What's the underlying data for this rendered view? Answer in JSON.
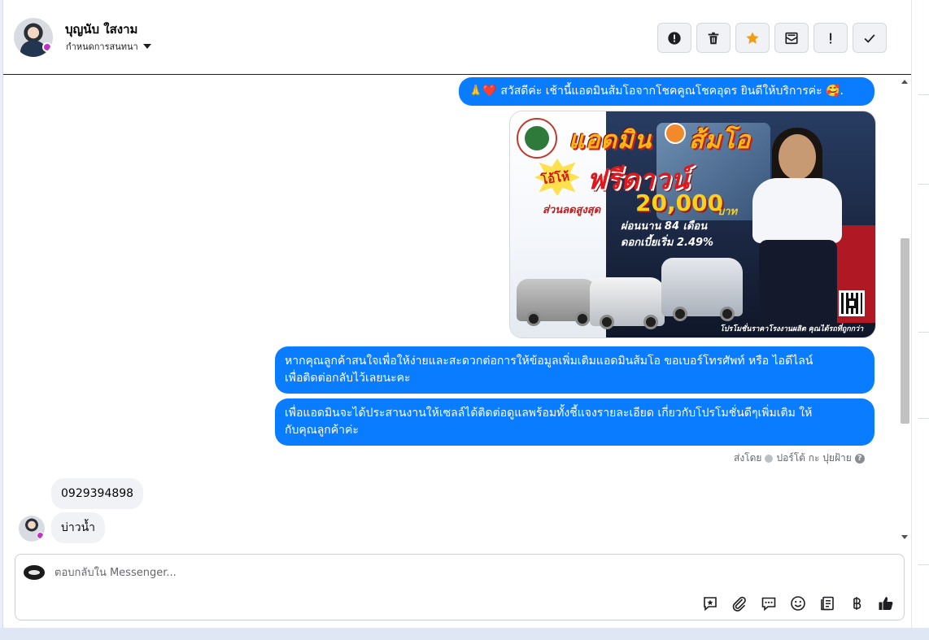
{
  "header": {
    "contact_name": "บุญนับ ใสงาม",
    "assign_label": "กำหนดการสนทนา",
    "actions": [
      {
        "name": "mark-spam-button",
        "icon": "alert-circle-icon"
      },
      {
        "name": "delete-button",
        "icon": "trash-icon"
      },
      {
        "name": "star-button",
        "icon": "star-icon",
        "color": "#f39c12"
      },
      {
        "name": "mark-unread-button",
        "icon": "envelope-icon"
      },
      {
        "name": "follow-up-button",
        "icon": "exclamation-icon"
      },
      {
        "name": "done-button",
        "icon": "check-icon"
      }
    ]
  },
  "messages": {
    "greeting": "🙏❤️ สวัสดีค่ะ เช้านี้แอดมินส้มโอจากโชคคูณโชคอุดร ยินดีให้บริการค่ะ 🥰.",
    "promo_image": {
      "title": "แอดมิน",
      "title_suffix": "ส้มโอ",
      "burst": "โอ้โห้",
      "headline": "ฟรีดาวน์",
      "discount_label": "ส่วนลดสูงสุด",
      "discount_amount": "20,000",
      "currency": "บาท",
      "term": "ผ่อนนาน 84 เดือน",
      "rate": "ดอกเบี้ยเริ่ม 2.49%",
      "footer": "โปรโมชั่นราคาโรงงานผลิต คุณได้รถที่ถูกกว่า"
    },
    "request_line1": "หากคุณลูกค้าสนใจเพื่อให้ง่ายและสะดวกต่อการให้ข้อมูลเพิ่มเติมแอดมินส้มโอ ขอเบอร์โทรศัพท์ หรือ ไอดีไลน์",
    "request_line2": "เพื่อติดต่อกลับไว้เลยนะคะ",
    "coordinate_line1": "เพื่อแอดมินจะได้ประสานงานให้เซลล์ได้ติดต่อดูแลพร้อมทั้งชี้แจงรายละเอียด เกี่ยวกับโปรโมชั่นดีๆเพิ่มเติม ให้",
    "coordinate_line2": "กับคุณลูกค้าค่ะ",
    "sent_by_prefix": "ส่งโดย",
    "sent_by_name": "ปอร์โต้ กะ ปุยฝ้าย",
    "help_glyph": "?",
    "incoming_phone": "0929394898",
    "incoming_text": "บ่าวน้ำ"
  },
  "composer": {
    "placeholder": "ตอบกลับใน Messenger...",
    "tools": [
      "saved-reply-icon",
      "attachment-icon",
      "chat-bubble-icon",
      "emoji-icon",
      "notes-icon",
      "baht-icon",
      "thumbs-up-icon"
    ]
  },
  "colors": {
    "accent": "#0a7cff",
    "incoming_bubble": "#f0f2f5",
    "star": "#f39c12"
  }
}
